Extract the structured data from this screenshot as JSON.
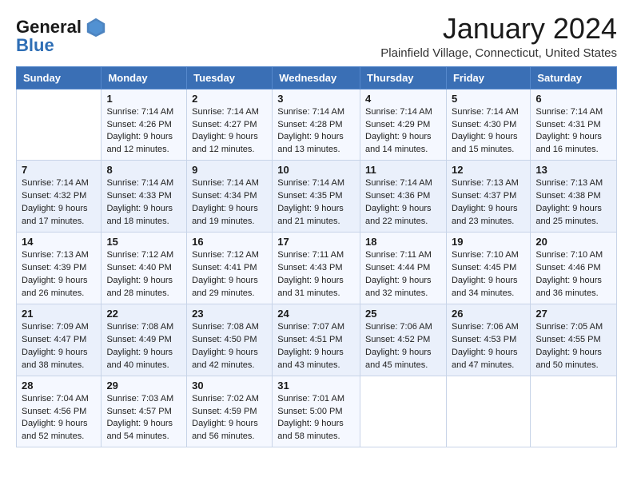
{
  "header": {
    "logo_general": "General",
    "logo_blue": "Blue",
    "month": "January 2024",
    "location": "Plainfield Village, Connecticut, United States"
  },
  "days_of_week": [
    "Sunday",
    "Monday",
    "Tuesday",
    "Wednesday",
    "Thursday",
    "Friday",
    "Saturday"
  ],
  "weeks": [
    [
      {
        "day": "",
        "sunrise": "",
        "sunset": "",
        "daylight": ""
      },
      {
        "day": "1",
        "sunrise": "Sunrise: 7:14 AM",
        "sunset": "Sunset: 4:26 PM",
        "daylight": "Daylight: 9 hours and 12 minutes."
      },
      {
        "day": "2",
        "sunrise": "Sunrise: 7:14 AM",
        "sunset": "Sunset: 4:27 PM",
        "daylight": "Daylight: 9 hours and 12 minutes."
      },
      {
        "day": "3",
        "sunrise": "Sunrise: 7:14 AM",
        "sunset": "Sunset: 4:28 PM",
        "daylight": "Daylight: 9 hours and 13 minutes."
      },
      {
        "day": "4",
        "sunrise": "Sunrise: 7:14 AM",
        "sunset": "Sunset: 4:29 PM",
        "daylight": "Daylight: 9 hours and 14 minutes."
      },
      {
        "day": "5",
        "sunrise": "Sunrise: 7:14 AM",
        "sunset": "Sunset: 4:30 PM",
        "daylight": "Daylight: 9 hours and 15 minutes."
      },
      {
        "day": "6",
        "sunrise": "Sunrise: 7:14 AM",
        "sunset": "Sunset: 4:31 PM",
        "daylight": "Daylight: 9 hours and 16 minutes."
      }
    ],
    [
      {
        "day": "7",
        "sunrise": "Sunrise: 7:14 AM",
        "sunset": "Sunset: 4:32 PM",
        "daylight": "Daylight: 9 hours and 17 minutes."
      },
      {
        "day": "8",
        "sunrise": "Sunrise: 7:14 AM",
        "sunset": "Sunset: 4:33 PM",
        "daylight": "Daylight: 9 hours and 18 minutes."
      },
      {
        "day": "9",
        "sunrise": "Sunrise: 7:14 AM",
        "sunset": "Sunset: 4:34 PM",
        "daylight": "Daylight: 9 hours and 19 minutes."
      },
      {
        "day": "10",
        "sunrise": "Sunrise: 7:14 AM",
        "sunset": "Sunset: 4:35 PM",
        "daylight": "Daylight: 9 hours and 21 minutes."
      },
      {
        "day": "11",
        "sunrise": "Sunrise: 7:14 AM",
        "sunset": "Sunset: 4:36 PM",
        "daylight": "Daylight: 9 hours and 22 minutes."
      },
      {
        "day": "12",
        "sunrise": "Sunrise: 7:13 AM",
        "sunset": "Sunset: 4:37 PM",
        "daylight": "Daylight: 9 hours and 23 minutes."
      },
      {
        "day": "13",
        "sunrise": "Sunrise: 7:13 AM",
        "sunset": "Sunset: 4:38 PM",
        "daylight": "Daylight: 9 hours and 25 minutes."
      }
    ],
    [
      {
        "day": "14",
        "sunrise": "Sunrise: 7:13 AM",
        "sunset": "Sunset: 4:39 PM",
        "daylight": "Daylight: 9 hours and 26 minutes."
      },
      {
        "day": "15",
        "sunrise": "Sunrise: 7:12 AM",
        "sunset": "Sunset: 4:40 PM",
        "daylight": "Daylight: 9 hours and 28 minutes."
      },
      {
        "day": "16",
        "sunrise": "Sunrise: 7:12 AM",
        "sunset": "Sunset: 4:41 PM",
        "daylight": "Daylight: 9 hours and 29 minutes."
      },
      {
        "day": "17",
        "sunrise": "Sunrise: 7:11 AM",
        "sunset": "Sunset: 4:43 PM",
        "daylight": "Daylight: 9 hours and 31 minutes."
      },
      {
        "day": "18",
        "sunrise": "Sunrise: 7:11 AM",
        "sunset": "Sunset: 4:44 PM",
        "daylight": "Daylight: 9 hours and 32 minutes."
      },
      {
        "day": "19",
        "sunrise": "Sunrise: 7:10 AM",
        "sunset": "Sunset: 4:45 PM",
        "daylight": "Daylight: 9 hours and 34 minutes."
      },
      {
        "day": "20",
        "sunrise": "Sunrise: 7:10 AM",
        "sunset": "Sunset: 4:46 PM",
        "daylight": "Daylight: 9 hours and 36 minutes."
      }
    ],
    [
      {
        "day": "21",
        "sunrise": "Sunrise: 7:09 AM",
        "sunset": "Sunset: 4:47 PM",
        "daylight": "Daylight: 9 hours and 38 minutes."
      },
      {
        "day": "22",
        "sunrise": "Sunrise: 7:08 AM",
        "sunset": "Sunset: 4:49 PM",
        "daylight": "Daylight: 9 hours and 40 minutes."
      },
      {
        "day": "23",
        "sunrise": "Sunrise: 7:08 AM",
        "sunset": "Sunset: 4:50 PM",
        "daylight": "Daylight: 9 hours and 42 minutes."
      },
      {
        "day": "24",
        "sunrise": "Sunrise: 7:07 AM",
        "sunset": "Sunset: 4:51 PM",
        "daylight": "Daylight: 9 hours and 43 minutes."
      },
      {
        "day": "25",
        "sunrise": "Sunrise: 7:06 AM",
        "sunset": "Sunset: 4:52 PM",
        "daylight": "Daylight: 9 hours and 45 minutes."
      },
      {
        "day": "26",
        "sunrise": "Sunrise: 7:06 AM",
        "sunset": "Sunset: 4:53 PM",
        "daylight": "Daylight: 9 hours and 47 minutes."
      },
      {
        "day": "27",
        "sunrise": "Sunrise: 7:05 AM",
        "sunset": "Sunset: 4:55 PM",
        "daylight": "Daylight: 9 hours and 50 minutes."
      }
    ],
    [
      {
        "day": "28",
        "sunrise": "Sunrise: 7:04 AM",
        "sunset": "Sunset: 4:56 PM",
        "daylight": "Daylight: 9 hours and 52 minutes."
      },
      {
        "day": "29",
        "sunrise": "Sunrise: 7:03 AM",
        "sunset": "Sunset: 4:57 PM",
        "daylight": "Daylight: 9 hours and 54 minutes."
      },
      {
        "day": "30",
        "sunrise": "Sunrise: 7:02 AM",
        "sunset": "Sunset: 4:59 PM",
        "daylight": "Daylight: 9 hours and 56 minutes."
      },
      {
        "day": "31",
        "sunrise": "Sunrise: 7:01 AM",
        "sunset": "Sunset: 5:00 PM",
        "daylight": "Daylight: 9 hours and 58 minutes."
      },
      {
        "day": "",
        "sunrise": "",
        "sunset": "",
        "daylight": ""
      },
      {
        "day": "",
        "sunrise": "",
        "sunset": "",
        "daylight": ""
      },
      {
        "day": "",
        "sunrise": "",
        "sunset": "",
        "daylight": ""
      }
    ]
  ]
}
